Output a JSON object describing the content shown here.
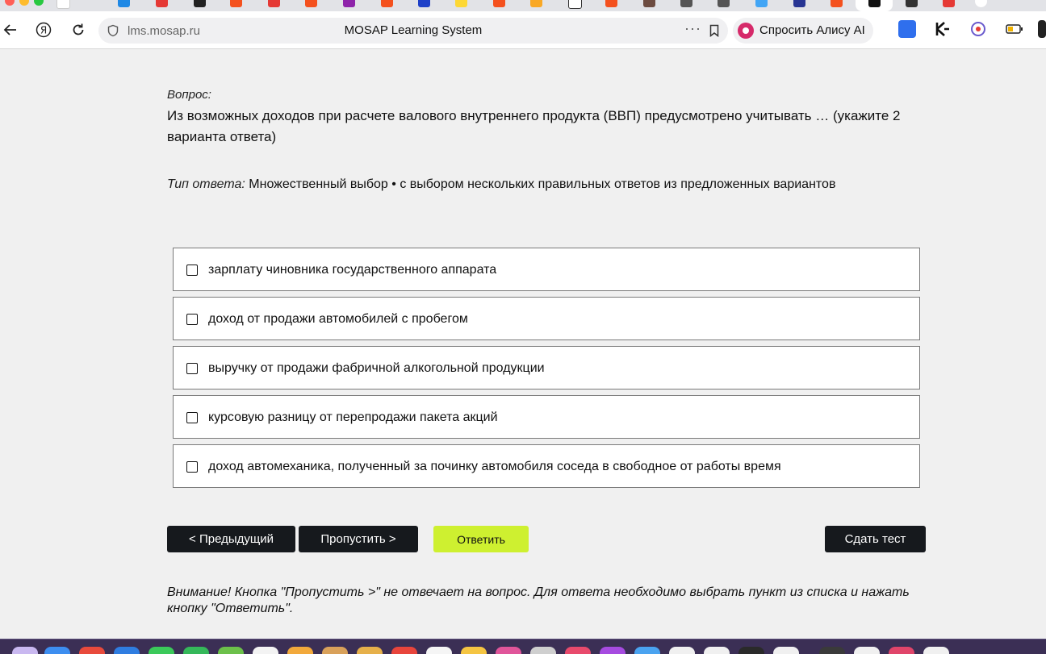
{
  "browser": {
    "url": "lms.mosap.ru",
    "page_title": "MOSAP Learning System",
    "more_icon": "···",
    "alice_label": "Спросить Алису AI"
  },
  "question": {
    "label": "Вопрос:",
    "text": "Из возможных доходов при расчете валового внутреннего продукта (ВВП) предусмотрено учитывать … (укажите 2 варианта ответа)",
    "type_label": "Тип ответа:",
    "type_value": "Множественный выбор • с выбором нескольких правильных ответов из предложенных вариантов"
  },
  "options": [
    {
      "text": "зарплату чиновника государственного аппарата"
    },
    {
      "text": "доход от продажи автомобилей с пробегом"
    },
    {
      "text": "выручку от продажи фабричной алкогольной продукции"
    },
    {
      "text": "курсовую разницу от перепродажи пакета акций"
    },
    {
      "text": "доход автомеханика, полученный за починку автомобиля соседа в свободное от работы время"
    }
  ],
  "buttons": {
    "prev": "< Предыдущий",
    "skip": "Пропустить >",
    "answer": "Ответить",
    "submit": "Сдать тест"
  },
  "note": "Внимание! Кнопка \"Пропустить >\" не отвечает на вопрос. Для ответа необходимо выбрать пункт из списка и нажать кнопку \"Ответить\".",
  "colors": {
    "page_bg": "#f0f0f0",
    "dark_button": "#16191d",
    "answer_button": "#cef030",
    "option_border": "#7a7a7a"
  }
}
